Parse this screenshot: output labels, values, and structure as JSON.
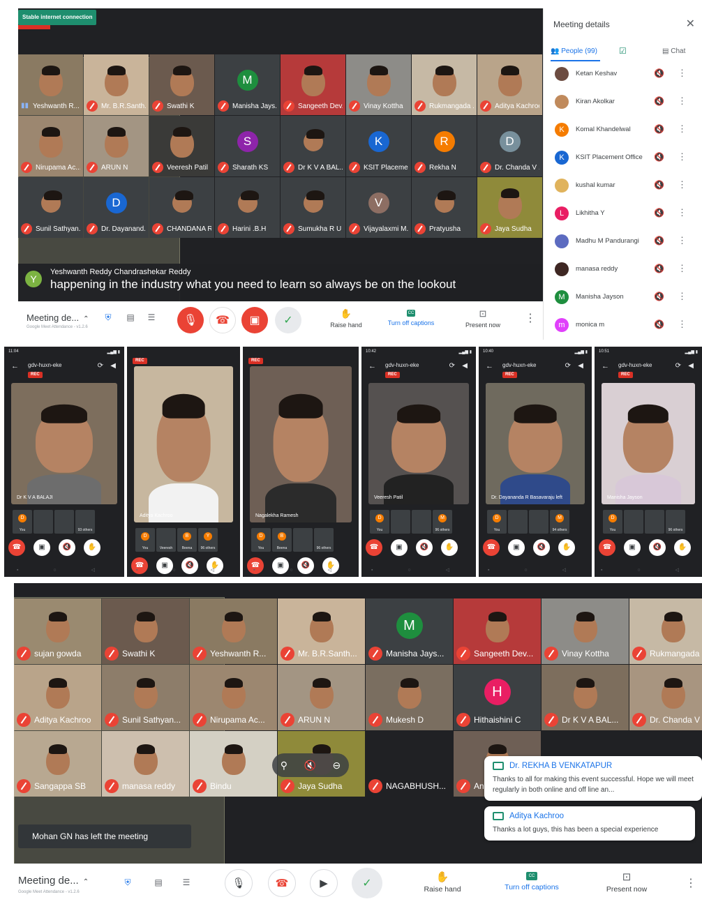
{
  "top": {
    "connection_badge": "Stable internet connection",
    "tiles": [
      {
        "name": "Yeshwanth R...",
        "kind": "video",
        "mic": "on",
        "bg": "#8a7a62"
      },
      {
        "name": "Mr. B.R.Santh...",
        "kind": "video",
        "mic": "off",
        "bg": "#c9b49a"
      },
      {
        "name": "Swathi K",
        "kind": "video",
        "mic": "off",
        "bg": "#6b5a4e"
      },
      {
        "name": "Manisha Jays...",
        "kind": "avatar",
        "initial": "M",
        "color": "#1e8e3e",
        "mic": "off"
      },
      {
        "name": "Sangeeth Dev...",
        "kind": "video",
        "mic": "off",
        "bg": "#b63a3a"
      },
      {
        "name": "Vinay Kottha",
        "kind": "video",
        "mic": "off",
        "bg": "#8d8c88"
      },
      {
        "name": "Rukmangada ...",
        "kind": "video",
        "mic": "off",
        "bg": "#c6b9a5"
      },
      {
        "name": "Aditya Kachroo",
        "kind": "video",
        "mic": "off",
        "bg": "#b9a48a"
      },
      {
        "name": "Nirupama Ac...",
        "kind": "video",
        "mic": "off",
        "bg": "#9c8770"
      },
      {
        "name": "ARUN N",
        "kind": "video",
        "mic": "off",
        "bg": "#a39583"
      },
      {
        "name": "Veeresh Patil",
        "kind": "video",
        "mic": "off",
        "bg": "#3a3a38"
      },
      {
        "name": "Sharath KS",
        "kind": "avatar",
        "initial": "S",
        "color": "#8e24aa",
        "mic": "off"
      },
      {
        "name": "Dr K V A BAL...",
        "kind": "photo",
        "mic": "off"
      },
      {
        "name": "KSIT Placeme...",
        "kind": "avatar",
        "initial": "K",
        "color": "#1967d2",
        "mic": "off"
      },
      {
        "name": "Rekha N",
        "kind": "avatar",
        "initial": "R",
        "color": "#f57c00",
        "mic": "off"
      },
      {
        "name": "Dr. Chanda V ...",
        "kind": "avatar",
        "initial": "D",
        "color": "#78909c",
        "mic": "off"
      },
      {
        "name": "Sunil Sathyan...",
        "kind": "photo",
        "mic": "off"
      },
      {
        "name": "Dr. Dayanand...",
        "kind": "avatar",
        "initial": "D",
        "color": "#1967d2",
        "mic": "off"
      },
      {
        "name": "CHANDANA R",
        "kind": "photo",
        "mic": "off"
      },
      {
        "name": "Harini .B.H",
        "kind": "photo",
        "mic": "off"
      },
      {
        "name": "Sumukha R U",
        "kind": "photo",
        "mic": "off"
      },
      {
        "name": "Vijayalaxmi M...",
        "kind": "avatar",
        "initial": "V",
        "color": "#8d6e63",
        "mic": "off"
      },
      {
        "name": "Pratyusha",
        "kind": "photo",
        "mic": "off"
      },
      {
        "name": "Jaya Sudha",
        "kind": "video",
        "mic": "off",
        "bg": "#8f8a3a"
      }
    ],
    "caption": {
      "initial": "Y",
      "speaker": "Yeshwanth Reddy Chandrashekar Reddy",
      "text": "happening in the industry what you need to learn so always be on the lookout"
    },
    "bar": {
      "meeting_title": "Meeting de...",
      "extension_text": "Google Meet Attendance - v1.2.6",
      "raise_hand": "Raise hand",
      "captions": "Turn off captions",
      "captions_icon": "CC",
      "present": "Present now"
    },
    "sidebar": {
      "title": "Meeting details",
      "people_tab": "People (99)",
      "chat_tab": "Chat",
      "people": [
        {
          "name": "Ketan Keshav",
          "kind": "photo",
          "color": "#6d4c41"
        },
        {
          "name": "Kiran Akolkar",
          "kind": "photo",
          "color": "#c08a5c"
        },
        {
          "name": "Komal Khandelwal",
          "kind": "initial",
          "initial": "K",
          "color": "#f57c00"
        },
        {
          "name": "KSIT Placement Office",
          "kind": "initial",
          "initial": "K",
          "color": "#1967d2"
        },
        {
          "name": "kushal kumar",
          "kind": "photo",
          "color": "#e0b35c"
        },
        {
          "name": "Likhitha Y",
          "kind": "initial",
          "initial": "L",
          "color": "#e91e63"
        },
        {
          "name": "Madhu M Pandurangi",
          "kind": "photo",
          "color": "#5c6bc0"
        },
        {
          "name": "manasa reddy",
          "kind": "photo",
          "color": "#3e2723"
        },
        {
          "name": "Manisha Jayson",
          "kind": "initial",
          "initial": "M",
          "color": "#1e8e3e"
        },
        {
          "name": "monica m",
          "kind": "initial",
          "initial": "m",
          "color": "#e040fb"
        }
      ]
    }
  },
  "phones": [
    {
      "status_time": "11:04",
      "code": "gdv-huxn-eke",
      "rec": "REC",
      "speaker": "Dr K V A BALAJI",
      "thumbs": [
        {
          "initial": "D",
          "label": "You"
        },
        {
          "initial": "",
          "label": ""
        },
        {
          "initial": "",
          "label": ""
        },
        {
          "initial": "",
          "label": "93 others"
        }
      ],
      "bg": "#7d6e5d",
      "shirt": "#6d6d6d"
    },
    {
      "rec": "REC",
      "speaker": "Aditya Kachroo",
      "thumbs": [
        {
          "initial": "D",
          "label": "You"
        },
        {
          "initial": "",
          "label": "Veeresh"
        },
        {
          "initial": "B",
          "label": "Beena"
        },
        {
          "initial": "Y",
          "label": "96 others"
        }
      ],
      "bg": "#c7b79f",
      "shirt": "#f2f2f2"
    },
    {
      "rec": "REC",
      "speaker": "Nagalekha Ramesh",
      "thumbs": [
        {
          "initial": "D",
          "label": "You"
        },
        {
          "initial": "B",
          "label": "Beena"
        },
        {
          "initial": "",
          "label": ""
        },
        {
          "initial": "",
          "label": "96 others"
        }
      ],
      "bg": "#6e5f55",
      "shirt": "#2b2b2b"
    },
    {
      "status_time": "10:42",
      "code": "gdv-huxn-eke",
      "rec": "REC",
      "speaker": "Veeresh Patil",
      "thumbs": [
        {
          "initial": "D",
          "label": "You"
        },
        {
          "initial": "",
          "label": ""
        },
        {
          "initial": "",
          "label": ""
        },
        {
          "initial": "M",
          "label": "96 others"
        }
      ],
      "bg": "#555150",
      "shirt": "#222"
    },
    {
      "status_time": "10:40",
      "code": "gdv-huxn-eke",
      "rec": "REC",
      "speaker": "Dr. Dayananda R Basavaraju left",
      "thumbs": [
        {
          "initial": "D",
          "label": "You"
        },
        {
          "initial": "",
          "label": ""
        },
        {
          "initial": "",
          "label": ""
        },
        {
          "initial": "M",
          "label": "94 others"
        }
      ],
      "bg": "#6f6a5e",
      "shirt": "#2f4a8a"
    },
    {
      "status_time": "10:51",
      "code": "gdv-huxn-eke",
      "rec": "REC",
      "speaker": "Manisha Jayson",
      "thumbs": [
        {
          "initial": "D",
          "label": "You"
        },
        {
          "initial": "",
          "label": ""
        },
        {
          "initial": "",
          "label": ""
        },
        {
          "initial": "",
          "label": "96 others"
        }
      ],
      "bg": "#d9cfd3",
      "shirt": "#d8c8d8"
    }
  ],
  "bottom": {
    "tiles": [
      {
        "name": "sujan gowda",
        "kind": "video",
        "mic": "off",
        "bg": "#9a8a70"
      },
      {
        "name": "Swathi K",
        "kind": "video",
        "mic": "off",
        "bg": "#6b5a4e"
      },
      {
        "name": "Yeshwanth R...",
        "kind": "video",
        "mic": "off",
        "bg": "#8a7a62"
      },
      {
        "name": "Mr. B.R.Santh...",
        "kind": "video",
        "mic": "off",
        "bg": "#c9b49a"
      },
      {
        "name": "Manisha Jays...",
        "kind": "avatar",
        "initial": "M",
        "color": "#1e8e3e",
        "mic": "off"
      },
      {
        "name": "Sangeeth Dev...",
        "kind": "video",
        "mic": "off",
        "bg": "#b63a3a"
      },
      {
        "name": "Vinay Kottha",
        "kind": "video",
        "mic": "off",
        "bg": "#8d8c88"
      },
      {
        "name": "Rukmangada ...",
        "kind": "video",
        "mic": "off",
        "bg": "#c6b9a5"
      },
      {
        "name": "Aditya Kachroo",
        "kind": "video",
        "mic": "off",
        "bg": "#b9a48a"
      },
      {
        "name": "Sunil Sathyan...",
        "kind": "video",
        "mic": "off",
        "bg": "#8d7d6a"
      },
      {
        "name": "Nirupama Ac...",
        "kind": "video",
        "mic": "off",
        "bg": "#9c8770"
      },
      {
        "name": "ARUN N",
        "kind": "video",
        "mic": "off",
        "bg": "#a39583"
      },
      {
        "name": "Mukesh D",
        "kind": "video",
        "mic": "off",
        "bg": "#7a6e60"
      },
      {
        "name": "Hithaishini C",
        "kind": "avatar",
        "initial": "H",
        "color": "#e91e63",
        "mic": "off"
      },
      {
        "name": "Dr K V A BAL...",
        "kind": "video",
        "mic": "off",
        "bg": "#7d6e5d"
      },
      {
        "name": "Dr. Chanda V ...",
        "kind": "video",
        "mic": "off",
        "bg": "#a89580"
      },
      {
        "name": "Sangappa SB",
        "kind": "video",
        "mic": "off",
        "bg": "#b8a891"
      },
      {
        "name": "manasa reddy",
        "kind": "video",
        "mic": "off",
        "bg": "#cdbfae"
      },
      {
        "name": "Bindu",
        "kind": "video",
        "mic": "off",
        "bg": "#d4d0c4"
      },
      {
        "name": "Jaya Sudha",
        "kind": "video",
        "mic": "off",
        "bg": "#8f8a3a"
      },
      {
        "name": "NAGABHUSH...",
        "kind": "blank",
        "mic": "off"
      },
      {
        "name": "Anil",
        "kind": "video",
        "mic": "off",
        "bg": "#6e5f55"
      }
    ],
    "notice": "Mohan GN has left the meeting",
    "chats": [
      {
        "name": "Dr. REKHA B VENKATAPUR",
        "text": "Thanks to all for making this event successful. Hope we will meet regularly in both online and off line an..."
      },
      {
        "name": "Aditya Kachroo",
        "text": "Thanks a lot guys, this has been a special experience"
      }
    ],
    "bar": {
      "meeting_title": "Meeting de...",
      "extension_text": "Google Meet Attendance - v1.2.6",
      "raise_hand": "Raise hand",
      "captions": "Turn off captions",
      "captions_icon": "CC",
      "present": "Present now"
    }
  }
}
